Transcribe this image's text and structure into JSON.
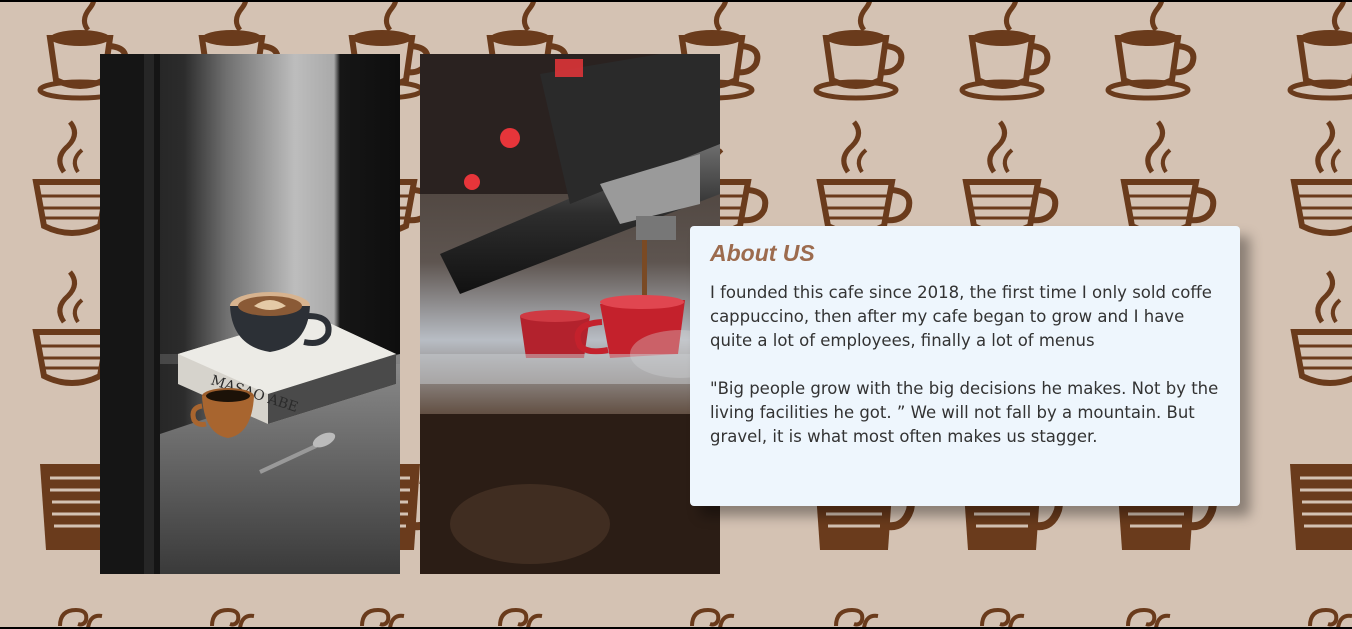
{
  "about": {
    "title": "About US",
    "paragraph_1": "I founded this cafe since 2018, the first time I only sold coffe cappuccino, then after my cafe began to grow and I have quite a lot of employees, finally a lot of menus",
    "paragraph_2": "\"Big people grow with the big decisions he makes. Not by the living facilities he got. ” We will not fall by a mountain. But gravel, it is what most often makes us stagger."
  },
  "colors": {
    "background": "#d4c2b3",
    "pattern": "#6a3b1c",
    "card": "#eef6fd",
    "title": "#9c6b4e",
    "text": "#333333"
  },
  "images": {
    "left_photo": "coffee-cup-on-book-photo",
    "right_photo": "espresso-machine-photo"
  }
}
